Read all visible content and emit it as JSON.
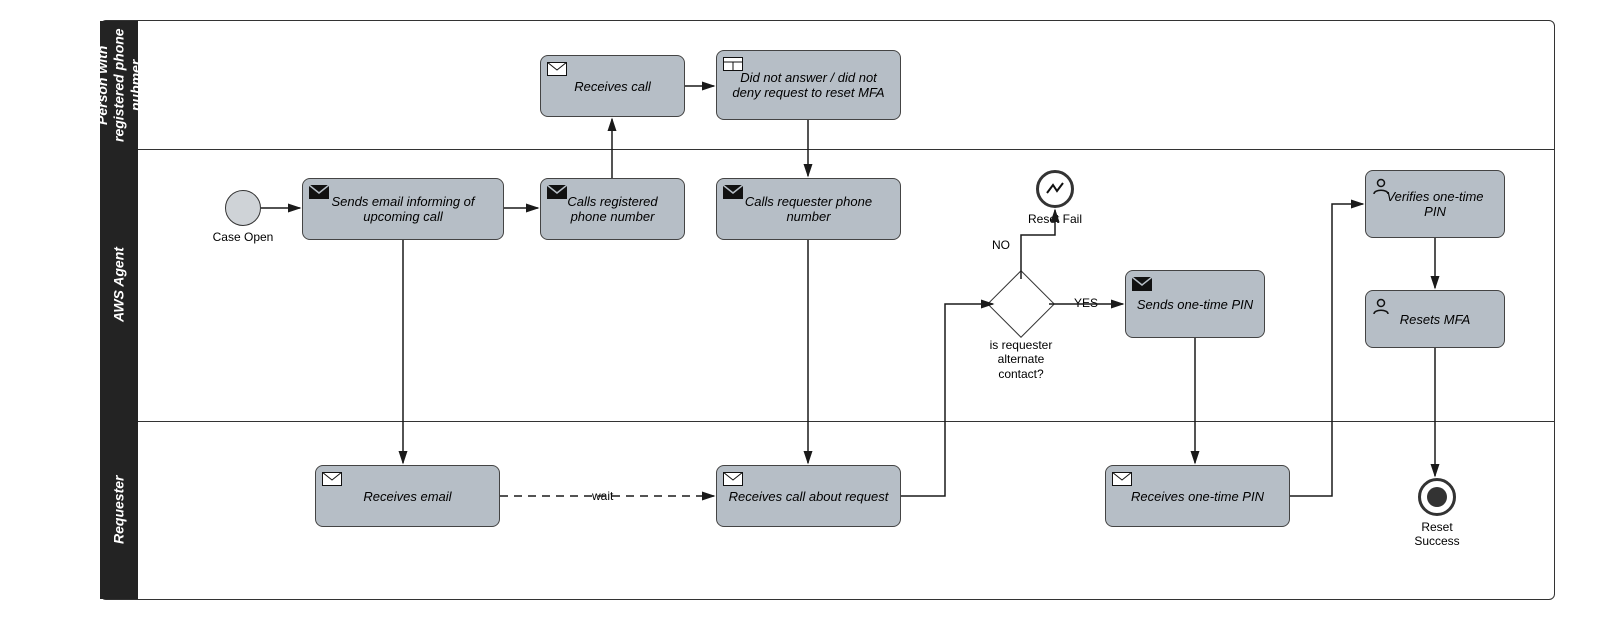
{
  "lanes": {
    "person": "Person with registered phone nubmer",
    "agent": "AWS Agent",
    "requester": "Requester"
  },
  "tasks": {
    "sends_email": "Sends email informing of upcoming call",
    "calls_registered": "Calls registered phone number",
    "receives_call": "Receives call",
    "did_not_answer": "Did not answer / did not deny request to reset MFA",
    "calls_requester": "Calls requester phone number",
    "receives_email": "Receives email",
    "receives_call_about": "Receives call about request",
    "sends_pin": "Sends one-time PIN",
    "receives_pin": "Receives one-time PIN",
    "verifies_pin": "Verifies one-time PIN",
    "resets_mfa": "Resets MFA"
  },
  "events": {
    "case_open": "Case Open",
    "reset_fail": "Reset Fail",
    "reset_success": "Reset Success"
  },
  "gateway": {
    "question": "is requester alternate contact?",
    "yes": "YES",
    "no": "NO"
  },
  "labels": {
    "wait": "wait"
  }
}
